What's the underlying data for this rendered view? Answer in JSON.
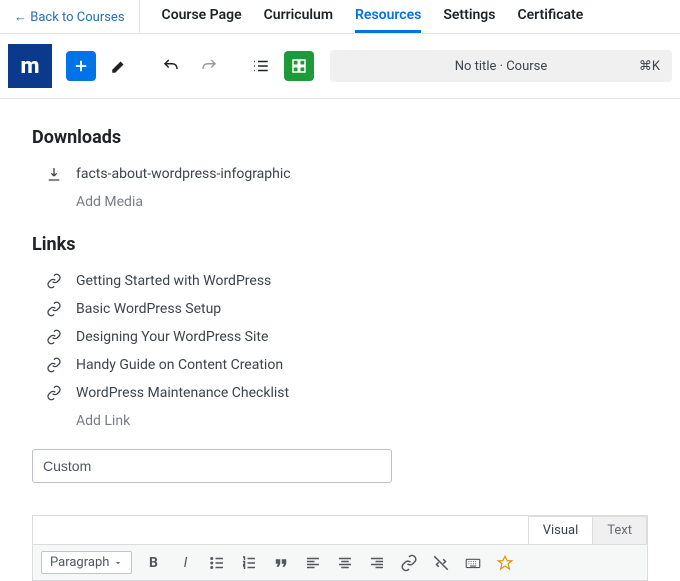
{
  "back_label": "← Back to Courses",
  "tabs": [
    "Course Page",
    "Curriculum",
    "Resources",
    "Settings",
    "Certificate"
  ],
  "active_tab": 2,
  "titlebar": {
    "text": "No title · Course",
    "shortcut": "⌘K"
  },
  "sections": {
    "downloads": {
      "heading": "Downloads",
      "items": [
        "facts-about-wordpress-infographic"
      ],
      "add_label": "Add Media"
    },
    "links": {
      "heading": "Links",
      "items": [
        "Getting Started with WordPress",
        "Basic WordPress Setup",
        "Designing Your WordPress Site",
        "Handy Guide on Content Creation",
        "WordPress Maintenance Checklist"
      ],
      "add_label": "Add Link"
    }
  },
  "custom_field": {
    "value": "Custom"
  },
  "editor": {
    "tabs": [
      "Visual",
      "Text"
    ],
    "active": 0,
    "format_label": "Paragraph"
  }
}
